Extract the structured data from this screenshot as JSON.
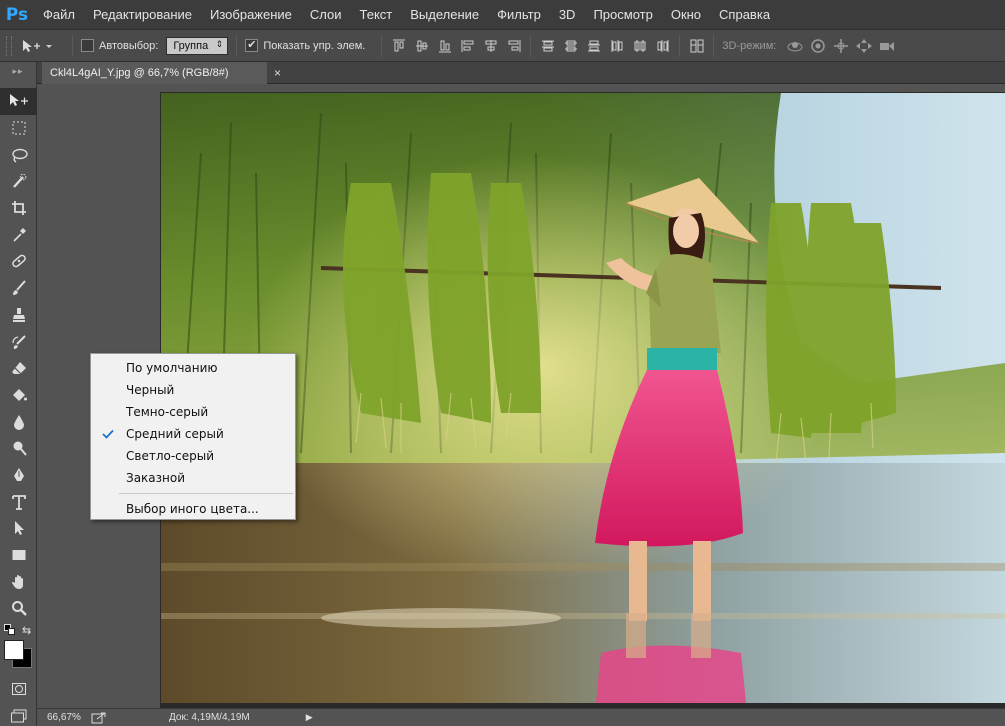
{
  "app": {
    "logo_text": "Ps",
    "accent_color": "#31a8ff"
  },
  "menu": {
    "items": [
      {
        "label": "Файл"
      },
      {
        "label": "Редактирование"
      },
      {
        "label": "Изображение"
      },
      {
        "label": "Слои"
      },
      {
        "label": "Текст"
      },
      {
        "label": "Выделение"
      },
      {
        "label": "Фильтр"
      },
      {
        "label": "3D"
      },
      {
        "label": "Просмотр"
      },
      {
        "label": "Окно"
      },
      {
        "label": "Справка"
      }
    ]
  },
  "options": {
    "autoselect_label": "Автовыбор:",
    "autoselect_checked": false,
    "autoselect_value": "Группа",
    "show_transform_label": "Показать упр. элем.",
    "show_transform_checked": true,
    "mode_3d_label": "3D-режим:",
    "align_icons": [
      "align-top-icon",
      "align-vertical-center-icon",
      "align-bottom-icon",
      "align-left-icon",
      "align-horizontal-center-icon",
      "align-right-icon"
    ],
    "distribute_icons": [
      "distribute-top-icon",
      "distribute-vertical-center-icon",
      "distribute-bottom-icon",
      "distribute-left-icon",
      "distribute-horizontal-center-icon",
      "distribute-right-icon"
    ],
    "auto_align_icon": "auto-align-layers-icon",
    "mode_3d_icons": [
      "rotate-3d-icon",
      "roll-3d-icon",
      "drag-3d-icon",
      "slide-3d-icon",
      "scale-3d-icon"
    ]
  },
  "document": {
    "tab_title": "Ckl4L4gAI_Y.jpg @ 66,7% (RGB/8#)",
    "close_glyph": "×"
  },
  "tools": [
    {
      "name": "move-tool-icon",
      "active": true
    },
    {
      "name": "marquee-tool-icon"
    },
    {
      "name": "lasso-tool-icon"
    },
    {
      "name": "quick-selection-tool-icon"
    },
    {
      "name": "crop-tool-icon"
    },
    {
      "name": "eyedropper-tool-icon"
    },
    {
      "name": "healing-brush-tool-icon"
    },
    {
      "name": "brush-tool-icon"
    },
    {
      "name": "clone-stamp-tool-icon"
    },
    {
      "name": "history-brush-tool-icon"
    },
    {
      "name": "eraser-tool-icon"
    },
    {
      "name": "paint-bucket-tool-icon"
    },
    {
      "name": "blur-tool-icon"
    },
    {
      "name": "dodge-tool-icon"
    },
    {
      "name": "pen-tool-icon"
    },
    {
      "name": "type-tool-icon"
    },
    {
      "name": "path-selection-tool-icon"
    },
    {
      "name": "rectangle-tool-icon"
    },
    {
      "name": "hand-tool-icon"
    },
    {
      "name": "zoom-tool-icon"
    }
  ],
  "colors": {
    "foreground": "#ffffff",
    "background": "#000000"
  },
  "context_menu": {
    "items": [
      {
        "label": "По умолчанию",
        "checked": false
      },
      {
        "label": "Черный",
        "checked": false
      },
      {
        "label": "Темно-серый",
        "checked": false
      },
      {
        "label": "Средний серый",
        "checked": true
      },
      {
        "label": "Светло-серый",
        "checked": false
      },
      {
        "label": "Заказной",
        "checked": false
      }
    ],
    "extra_item": "Выбор иного цвета..."
  },
  "status": {
    "zoom": "66,67%",
    "doc_info": "Док: 4,19M/4,19M",
    "arrow": "▶"
  }
}
